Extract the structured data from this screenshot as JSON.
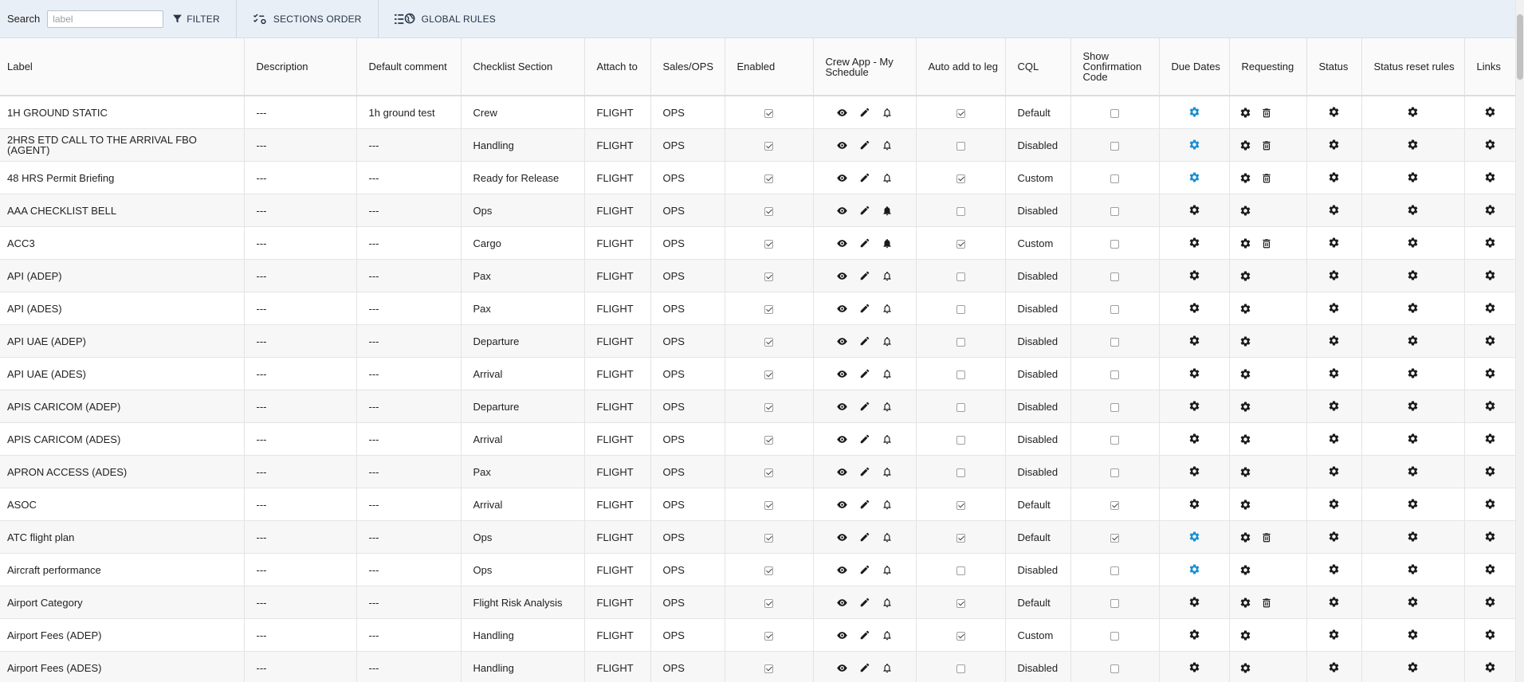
{
  "toolbar": {
    "search_label": "Search",
    "search_placeholder": "label",
    "filter_label": "FILTER",
    "sections_order_label": "SECTIONS ORDER",
    "global_rules_label": "GLOBAL RULES"
  },
  "columns": {
    "label": "Label",
    "description": "Description",
    "default_comment": "Default comment",
    "checklist_section": "Checklist Section",
    "attach_to": "Attach to",
    "sales_ops": "Sales/OPS",
    "enabled": "Enabled",
    "crew_app": "Crew App - My Schedule",
    "auto_add": "Auto add to leg",
    "cql": "CQL",
    "show_confirmation": "Show Confirmation Code",
    "due_dates": "Due Dates",
    "requesting": "Requesting",
    "status": "Status",
    "status_reset": "Status reset rules",
    "links": "Links"
  },
  "colors": {
    "toolbar_bg": "#e9eff6",
    "gear_active": "#1a8fd0",
    "gear_default": "#1a1a1a"
  },
  "rows": [
    {
      "label": "1H GROUND STATIC",
      "description": "---",
      "comment": "1h ground test",
      "section": "Crew",
      "attach": "FLIGHT",
      "sales": "OPS",
      "enabled": true,
      "bell": "outline",
      "auto_add": true,
      "cql": "Default",
      "confirm": false,
      "due_active": true,
      "req_delete": true
    },
    {
      "label": "2HRS ETD CALL TO THE ARRIVAL FBO (AGENT)",
      "description": "---",
      "comment": "---",
      "section": "Handling",
      "attach": "FLIGHT",
      "sales": "OPS",
      "enabled": true,
      "bell": "outline",
      "auto_add": false,
      "cql": "Disabled",
      "confirm": false,
      "due_active": true,
      "req_delete": true
    },
    {
      "label": "48 HRS Permit Briefing",
      "description": "---",
      "comment": "---",
      "section": "Ready for Release",
      "attach": "FLIGHT",
      "sales": "OPS",
      "enabled": true,
      "bell": "outline",
      "auto_add": true,
      "cql": "Custom",
      "confirm": false,
      "due_active": true,
      "req_delete": true
    },
    {
      "label": "AAA CHECKLIST BELL",
      "description": "---",
      "comment": "---",
      "section": "Ops",
      "attach": "FLIGHT",
      "sales": "OPS",
      "enabled": true,
      "bell": "filled",
      "auto_add": false,
      "cql": "Disabled",
      "confirm": false,
      "due_active": false,
      "req_delete": false
    },
    {
      "label": "ACC3",
      "description": "---",
      "comment": "---",
      "section": "Cargo",
      "attach": "FLIGHT",
      "sales": "OPS",
      "enabled": true,
      "bell": "filled",
      "auto_add": true,
      "cql": "Custom",
      "confirm": false,
      "due_active": false,
      "req_delete": true
    },
    {
      "label": "API (ADEP)",
      "description": "---",
      "comment": "---",
      "section": "Pax",
      "attach": "FLIGHT",
      "sales": "OPS",
      "enabled": true,
      "bell": "outline",
      "auto_add": false,
      "cql": "Disabled",
      "confirm": false,
      "due_active": false,
      "req_delete": false
    },
    {
      "label": "API (ADES)",
      "description": "---",
      "comment": "---",
      "section": "Pax",
      "attach": "FLIGHT",
      "sales": "OPS",
      "enabled": true,
      "bell": "outline",
      "auto_add": false,
      "cql": "Disabled",
      "confirm": false,
      "due_active": false,
      "req_delete": false
    },
    {
      "label": "API UAE (ADEP)",
      "description": "---",
      "comment": "---",
      "section": "Departure",
      "attach": "FLIGHT",
      "sales": "OPS",
      "enabled": true,
      "bell": "outline",
      "auto_add": false,
      "cql": "Disabled",
      "confirm": false,
      "due_active": false,
      "req_delete": false
    },
    {
      "label": "API UAE (ADES)",
      "description": "---",
      "comment": "---",
      "section": "Arrival",
      "attach": "FLIGHT",
      "sales": "OPS",
      "enabled": true,
      "bell": "outline",
      "auto_add": false,
      "cql": "Disabled",
      "confirm": false,
      "due_active": false,
      "req_delete": false
    },
    {
      "label": "APIS CARICOM (ADEP)",
      "description": "---",
      "comment": "---",
      "section": "Departure",
      "attach": "FLIGHT",
      "sales": "OPS",
      "enabled": true,
      "bell": "outline",
      "auto_add": false,
      "cql": "Disabled",
      "confirm": false,
      "due_active": false,
      "req_delete": false
    },
    {
      "label": "APIS CARICOM (ADES)",
      "description": "---",
      "comment": "---",
      "section": "Arrival",
      "attach": "FLIGHT",
      "sales": "OPS",
      "enabled": true,
      "bell": "outline",
      "auto_add": false,
      "cql": "Disabled",
      "confirm": false,
      "due_active": false,
      "req_delete": false
    },
    {
      "label": "APRON ACCESS (ADES)",
      "description": "---",
      "comment": "---",
      "section": "Pax",
      "attach": "FLIGHT",
      "sales": "OPS",
      "enabled": true,
      "bell": "outline",
      "auto_add": false,
      "cql": "Disabled",
      "confirm": false,
      "due_active": false,
      "req_delete": false
    },
    {
      "label": "ASOC",
      "description": "---",
      "comment": "---",
      "section": "Arrival",
      "attach": "FLIGHT",
      "sales": "OPS",
      "enabled": true,
      "bell": "outline",
      "auto_add": true,
      "cql": "Default",
      "confirm": true,
      "due_active": false,
      "req_delete": false
    },
    {
      "label": "ATC flight plan",
      "description": "---",
      "comment": "---",
      "section": "Ops",
      "attach": "FLIGHT",
      "sales": "OPS",
      "enabled": true,
      "bell": "outline",
      "auto_add": true,
      "cql": "Default",
      "confirm": true,
      "due_active": true,
      "req_delete": true
    },
    {
      "label": "Aircraft performance",
      "description": "---",
      "comment": "---",
      "section": "Ops",
      "attach": "FLIGHT",
      "sales": "OPS",
      "enabled": true,
      "bell": "outline",
      "auto_add": false,
      "cql": "Disabled",
      "confirm": false,
      "due_active": true,
      "req_delete": false
    },
    {
      "label": "Airport Category",
      "description": "---",
      "comment": "---",
      "section": "Flight Risk Analysis",
      "attach": "FLIGHT",
      "sales": "OPS",
      "enabled": true,
      "bell": "outline",
      "auto_add": true,
      "cql": "Default",
      "confirm": false,
      "due_active": false,
      "req_delete": true
    },
    {
      "label": "Airport Fees (ADEP)",
      "description": "---",
      "comment": "---",
      "section": "Handling",
      "attach": "FLIGHT",
      "sales": "OPS",
      "enabled": true,
      "bell": "outline",
      "auto_add": true,
      "cql": "Custom",
      "confirm": false,
      "due_active": false,
      "req_delete": false
    },
    {
      "label": "Airport Fees (ADES)",
      "description": "---",
      "comment": "---",
      "section": "Handling",
      "attach": "FLIGHT",
      "sales": "OPS",
      "enabled": true,
      "bell": "outline",
      "auto_add": false,
      "cql": "Disabled",
      "confirm": false,
      "due_active": false,
      "req_delete": false
    }
  ]
}
